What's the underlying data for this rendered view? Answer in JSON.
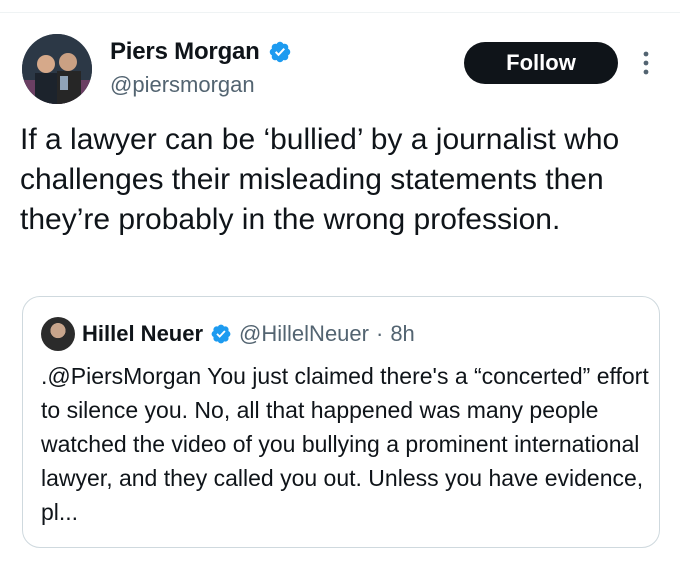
{
  "author": {
    "display_name": "Piers Morgan",
    "handle": "@piersmorgan",
    "verified": true
  },
  "follow_label": "Follow",
  "tweet": {
    "text": "If a lawyer can be ‘bullied’ by a journalist who challenges their misleading statements then they’re probably in the wrong profession."
  },
  "quoted": {
    "display_name": "Hillel Neuer",
    "handle": "@HillelNeuer",
    "separator": "·",
    "time": "8h",
    "text": ".@PiersMorgan You just claimed there's a “concerted” effort to silence you. No, all that happened was many people watched the video of you bullying a prominent international lawyer, and they called you out. Unless you have evidence, pl..."
  },
  "colors": {
    "verified_blue": "#1d9bf0",
    "text": "#0f1419",
    "secondary": "#536471",
    "border": "#cfd9de"
  }
}
